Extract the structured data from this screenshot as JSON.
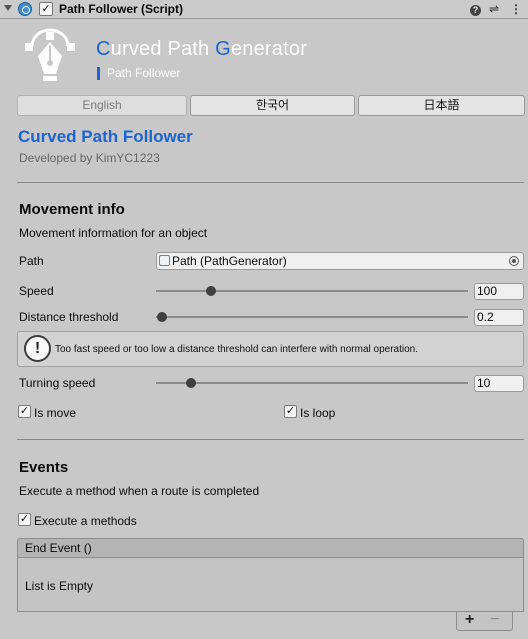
{
  "header": {
    "title": "Path Follower (Script)",
    "enabled_check": "✓",
    "help_icon": "?",
    "presets_icon": "⇌",
    "menu_icon": "⋮"
  },
  "banner": {
    "title_c": "C",
    "title_urved": "urved Path ",
    "title_g": "G",
    "title_enerator": "enerator",
    "subtitle": "Path Follower",
    "accent_color": "#1e63d2"
  },
  "languages": [
    {
      "label": "English",
      "active": true
    },
    {
      "label": "한국어",
      "active": false
    },
    {
      "label": "日本語",
      "active": false
    }
  ],
  "app": {
    "title": "Curved Path Follower",
    "author": "Developed by KimYC1223"
  },
  "movement": {
    "title": "Movement info",
    "desc": "Movement information for an object",
    "path_label": "Path",
    "path_value": "Path (PathGenerator)",
    "speed_label": "Speed",
    "speed_value": "100",
    "distance_label": "Distance threshold",
    "distance_value": "0.2",
    "warning_icon": "!",
    "warning_text": "Too fast speed or too low a distance threshold can interfere with normal operation.",
    "turning_label": "Turning speed",
    "turning_value": "10",
    "is_move_label": "Is move",
    "is_loop_label": "Is loop",
    "check_mark": "✓"
  },
  "events": {
    "title": "Events",
    "desc": "Execute a method when a route is completed",
    "execute_label": "Execute a methods",
    "list_header": "End Event ()",
    "list_empty": "List is Empty",
    "add_label": "+",
    "remove_label": "−"
  }
}
